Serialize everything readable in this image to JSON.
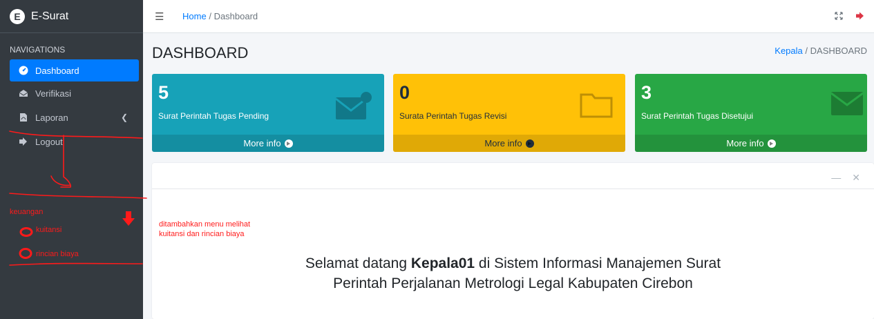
{
  "brand": {
    "logo_letter": "E",
    "name": "E-Surat"
  },
  "sidebar": {
    "header": "NAVIGATIONS",
    "items": [
      {
        "label": "Dashboard",
        "icon": "dashboard-icon",
        "active": true
      },
      {
        "label": "Verifikasi",
        "icon": "envelope-open-icon"
      },
      {
        "label": "Laporan",
        "icon": "file-pdf-icon"
      },
      {
        "label": "Logout",
        "icon": "sign-out-icon"
      }
    ]
  },
  "annotation": {
    "menu_group": "keuangan",
    "menu_item_1": "kuitansi",
    "menu_item_2": "rincian biaya",
    "note_line1": "ditambahkan menu melihat",
    "note_line2": "kuitansi dan rincian biaya",
    "color": "#ff1a1a"
  },
  "topbar": {
    "home": "Home",
    "separator": "/",
    "current": "Dashboard"
  },
  "page": {
    "title": "DASHBOARD",
    "crumb_link": "Kepala",
    "crumb_sep": "/",
    "crumb_current": "DASHBOARD"
  },
  "boxes": [
    {
      "count": "5",
      "label": "Surat Perintah Tugas Pending",
      "footer": "More info",
      "color": "#17a2b8",
      "icon": "envelope-badge-icon"
    },
    {
      "count": "0",
      "label": "Surata Perintah Tugas Revisi",
      "footer": "More info",
      "color": "#ffc107",
      "icon": "folder-icon"
    },
    {
      "count": "3",
      "label": "Surat Perintah Tugas Disetujui",
      "footer": "More info",
      "color": "#28a745",
      "icon": "envelope-icon"
    }
  ],
  "welcome": {
    "pre": "Selamat datang ",
    "user": "Kepala01",
    "post": " di Sistem Informasi Manajemen Surat",
    "line2": "Perintah Perjalanan Metrologi Legal Kabupaten Cirebon"
  },
  "colors": {
    "sidebar_bg": "#343a40",
    "primary": "#007bff"
  }
}
